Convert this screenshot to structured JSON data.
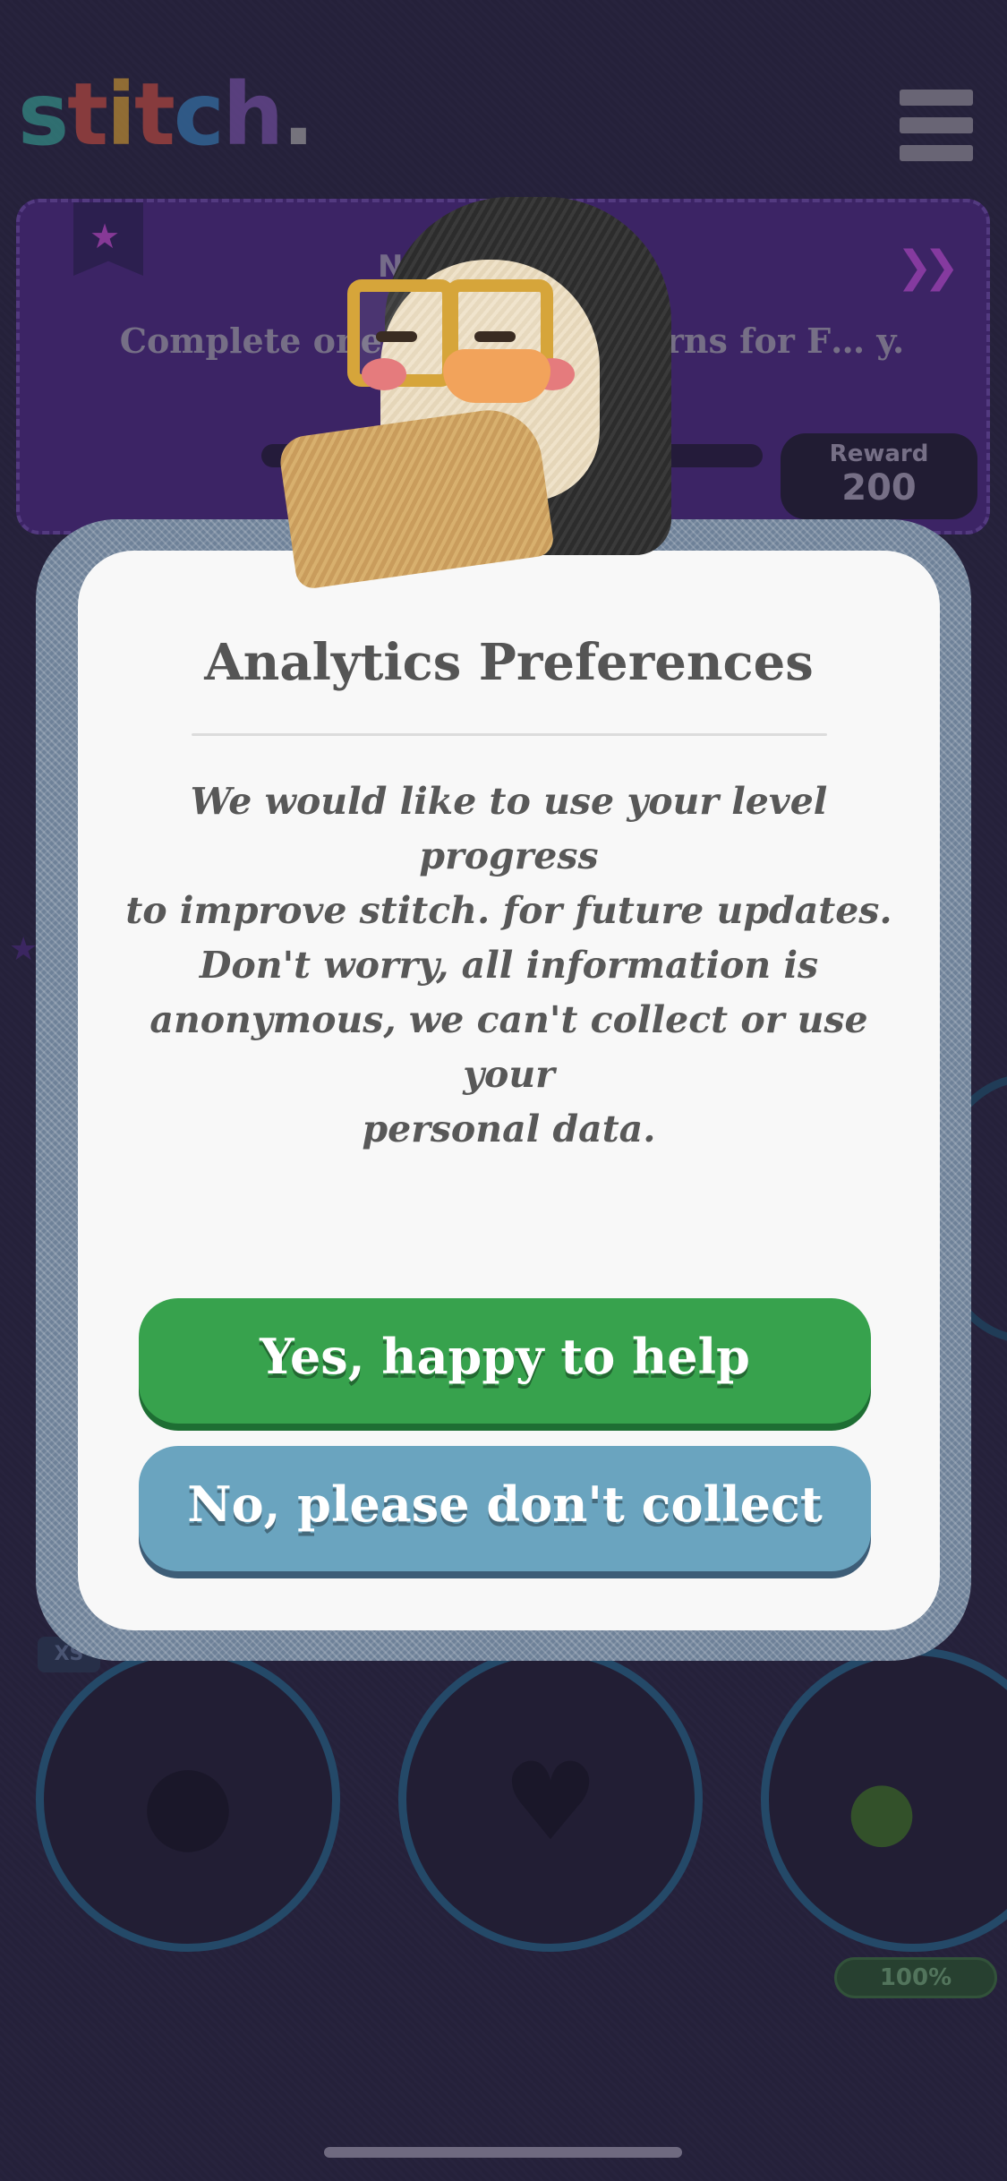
{
  "app": {
    "logo_text": "stitch.",
    "logo_colors": [
      "#3fb6a8",
      "#e0574a",
      "#f0b23a",
      "#e0574a",
      "#3f8fd0",
      "#8a5fc0",
      "#bfbfbf"
    ]
  },
  "menu": {
    "icon": "hamburger-menu-icon"
  },
  "challenge_banner": {
    "label": "N",
    "description": "Complete one or … the Patterns for F… y.",
    "reward_label": "Reward",
    "reward_value": "200",
    "accent_color": "#4b2c80"
  },
  "background": {
    "badge_text": "XS",
    "progress_percent_label": "100%"
  },
  "modal": {
    "title": "Analytics Preferences",
    "body": "We would like to use your level progress\nto improve stitch. for future updates.\nDon't worry, all information is\nanonymous, we can't collect or use your\npersonal data.",
    "accept_label": "Yes, happy to help",
    "decline_label": "No, please don't collect",
    "accept_color": "#37a24d",
    "decline_color": "#6aa4bf"
  }
}
